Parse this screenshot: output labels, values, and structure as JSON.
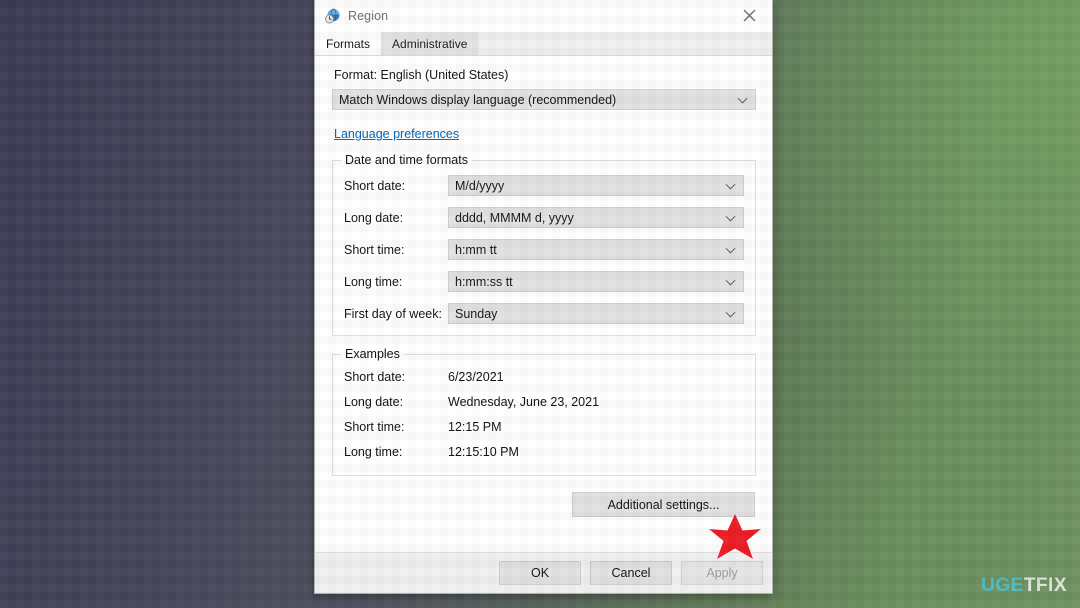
{
  "window": {
    "title": "Region",
    "title_icon": "globe-clock-icon",
    "close_label": "✕"
  },
  "tabs": [
    {
      "label": "Formats",
      "active": true
    },
    {
      "label": "Administrative",
      "active": false
    }
  ],
  "formats_tab": {
    "format_label": "Format: English (United States)",
    "format_combo_value": "Match Windows display language (recommended)",
    "language_preferences_link": "Language preferences",
    "date_time_group": {
      "title": "Date and time formats",
      "rows": [
        {
          "label": "Short date:",
          "value": "M/d/yyyy"
        },
        {
          "label": "Long date:",
          "value": "dddd, MMMM d, yyyy"
        },
        {
          "label": "Short time:",
          "value": "h:mm tt"
        },
        {
          "label": "Long time:",
          "value": "h:mm:ss tt"
        },
        {
          "label": "First day of week:",
          "value": "Sunday"
        }
      ]
    },
    "examples_group": {
      "title": "Examples",
      "rows": [
        {
          "label": "Short date:",
          "value": "6/23/2021"
        },
        {
          "label": "Long date:",
          "value": "Wednesday, June 23, 2021"
        },
        {
          "label": "Short time:",
          "value": "12:15 PM"
        },
        {
          "label": "Long time:",
          "value": "12:15:10 PM"
        }
      ]
    },
    "additional_settings_label": "Additional settings..."
  },
  "footer": {
    "ok_label": "OK",
    "cancel_label": "Cancel",
    "apply_label": "Apply"
  },
  "annotation": {
    "shape": "red-star",
    "color": "#ED1C24"
  },
  "watermark": {
    "part1": "UG",
    "part2": "E",
    "part3": "TFIX"
  },
  "colors": {
    "accent_link": "#0566b6",
    "combo_fill": "#e1e1e1",
    "window_bg": "#ffffff",
    "footer_bg": "#f0f0f0",
    "star_red": "#ED1C24",
    "watermark_teal": "#49c4d8"
  }
}
